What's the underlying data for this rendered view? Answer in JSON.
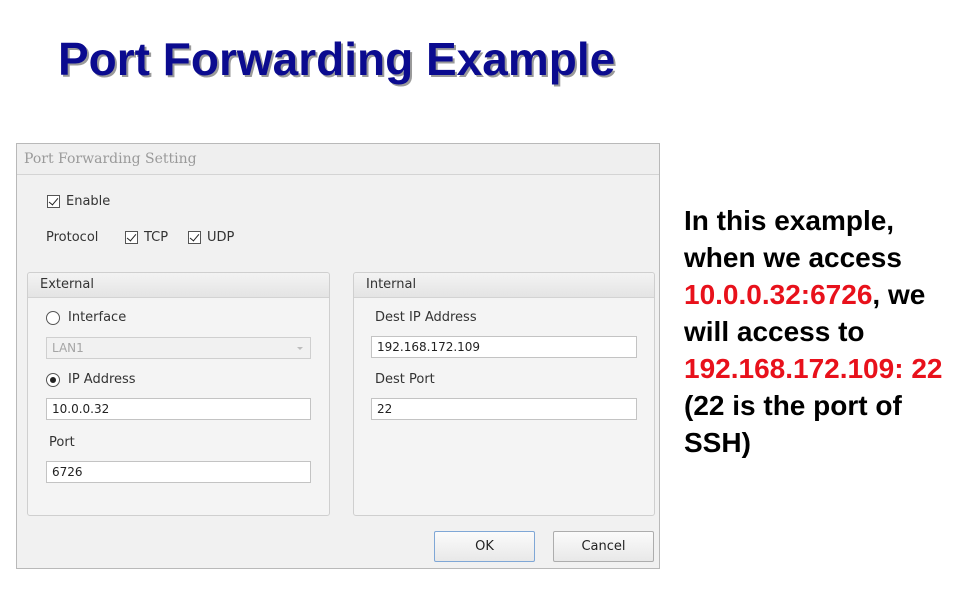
{
  "slide": {
    "title": "Port Forwarding Example"
  },
  "dialog": {
    "title": "Port Forwarding Setting",
    "enable": {
      "label": "Enable",
      "checked": true
    },
    "protocol": {
      "label": "Protocol",
      "tcp": {
        "label": "TCP",
        "checked": true
      },
      "udp": {
        "label": "UDP",
        "checked": true
      }
    },
    "external": {
      "header": "External",
      "interface_option": {
        "label": "Interface",
        "selected": false
      },
      "interface_select_value": "LAN1",
      "ip_option": {
        "label": "IP Address",
        "selected": true
      },
      "ip_value": "10.0.0.32",
      "port_label": "Port",
      "port_value": "6726"
    },
    "internal": {
      "header": "Internal",
      "dest_ip_label": "Dest IP Address",
      "dest_ip_value": "192.168.172.109",
      "dest_port_label": "Dest Port",
      "dest_port_value": "22"
    },
    "buttons": {
      "ok": "OK",
      "cancel": "Cancel"
    }
  },
  "explanation": {
    "line1": "In this example, when we access",
    "addr_external": "10.0.0.32:6726",
    "comma": ",",
    "line2": "we will access to",
    "addr_internal_a": "192.168.172.109:",
    "addr_internal_b": "22",
    "line3": "(22 is the port of SSH)"
  },
  "colors": {
    "title": "#0b0b8f",
    "highlight": "#e8111b"
  }
}
